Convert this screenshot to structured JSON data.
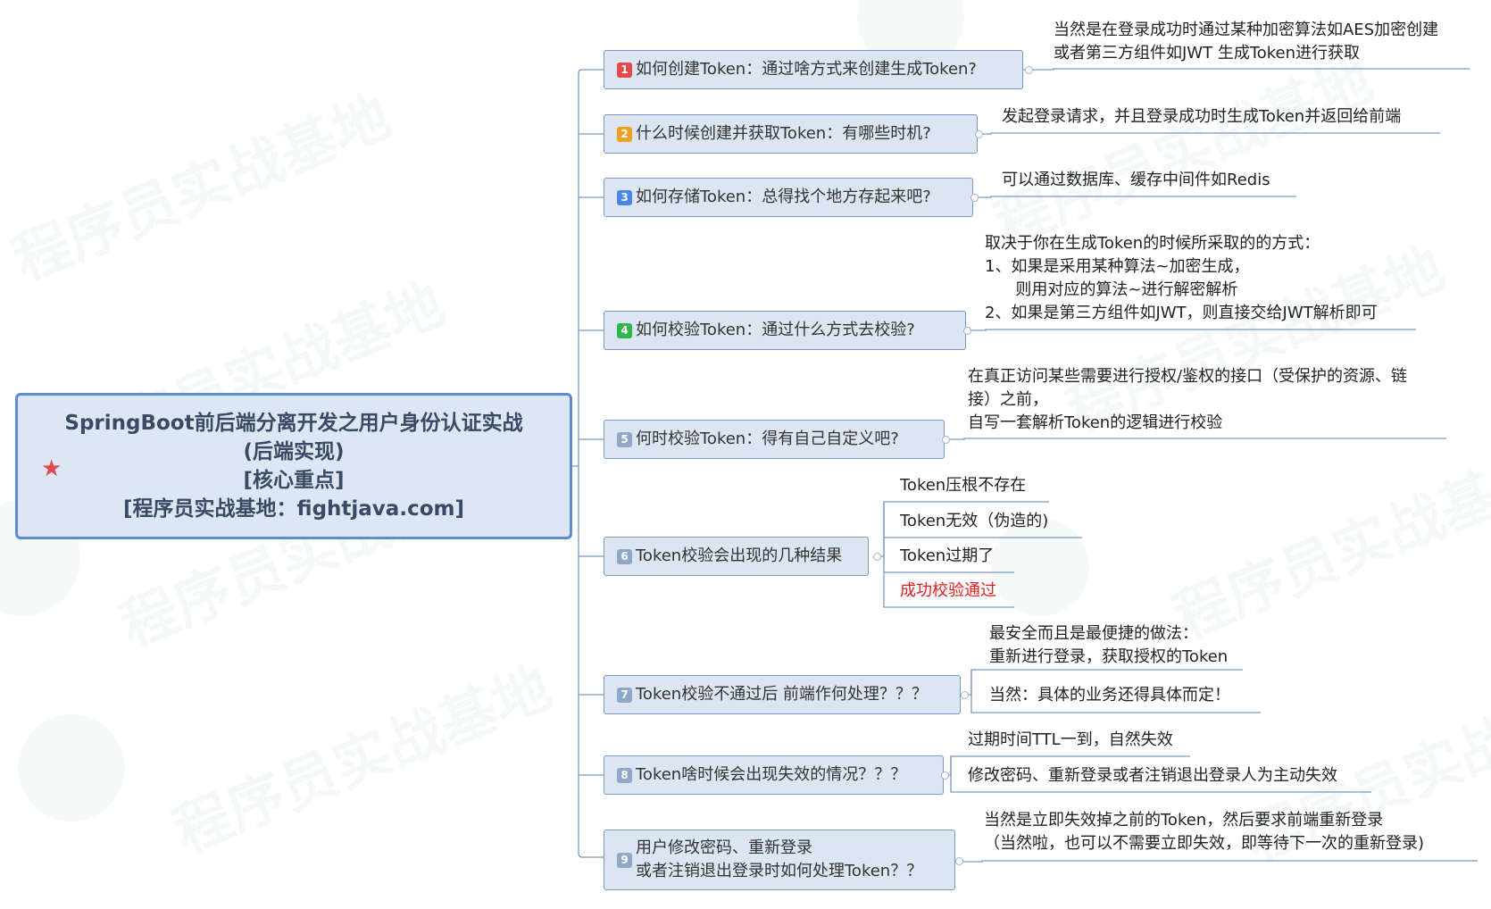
{
  "root": {
    "lines": [
      "SpringBoot前后端分离开发之用户身份认证实战",
      "(后端实现)",
      "[核心重点]",
      "[程序员实战基地：fightjava.com]"
    ],
    "marker_icon": "star-icon"
  },
  "watermark": "程序员实战基地",
  "topics": [
    {
      "badge": "1",
      "badge_color": "#e5484d",
      "label": "如何创建Token：通过啥方式来创建生成Token?"
    },
    {
      "badge": "2",
      "badge_color": "#f0a020",
      "label": "什么时候创建并获取Token：有哪些时机?"
    },
    {
      "badge": "3",
      "badge_color": "#4a86e8",
      "label": "如何存储Token：总得找个地方存起来吧?"
    },
    {
      "badge": "4",
      "badge_color": "#2eb84b",
      "label": "如何校验Token：通过什么方式去校验?"
    },
    {
      "badge": "5",
      "badge_color": "#8fa8c8",
      "label": "何时校验Token：得有自己自定义吧?"
    },
    {
      "badge": "6",
      "badge_color": "#8fa8c8",
      "label": "Token校验会出现的几种结果"
    },
    {
      "badge": "7",
      "badge_color": "#8fa8c8",
      "label": "Token校验不通过后 前端作何处理？？？"
    },
    {
      "badge": "8",
      "badge_color": "#8fa8c8",
      "label": "Token啥时候会出现失效的情况？？？"
    },
    {
      "badge": "9",
      "badge_color": "#8fa8c8",
      "label_lines": [
        "用户修改密码、重新登录",
        "或者注销退出登录时如何处理Token？？"
      ]
    }
  ],
  "notes": {
    "t1": [
      "当然是在登录成功时通过某种加密算法如AES加密创建",
      "或者第三方组件如JWT  生成Token进行获取"
    ],
    "t2": [
      "发起登录请求，并且登录成功时生成Token并返回给前端"
    ],
    "t3": [
      "可以通过数据库、缓存中间件如Redis"
    ],
    "t4": [
      "取决于你在生成Token的时候所采取的的方式：",
      "1、如果是采用某种算法~加密生成，",
      "      则用对应的算法~进行解密解析",
      "2、如果是第三方组件如JWT，则直接交给JWT解析即可"
    ],
    "t5": [
      "在真正访问某些需要进行授权/鉴权的接口（受保护的资源、链",
      "接）之前，",
      "自写一套解析Token的逻辑进行校验"
    ],
    "t6": [
      "Token压根不存在",
      "Token无效（伪造的)",
      "Token过期了",
      "成功校验通过"
    ],
    "t7a": [
      "最安全而且是最便捷的做法：",
      "重新进行登录，获取授权的Token"
    ],
    "t7b": [
      "当然：具体的业务还得具体而定！"
    ],
    "t8a": [
      "过期时间TTL一到，自然失效"
    ],
    "t8b": [
      "修改密码、重新登录或者注销退出登录人为主动失效"
    ],
    "t9": [
      "当然是立即失效掉之前的Token，然后要求前端重新登录",
      "（当然啦，也可以不需要立即失效，即等待下一次的重新登录)"
    ]
  },
  "colors": {
    "line": "#7a98c6",
    "topic_bg": "#dce5f2",
    "root_bg": "#dde6f3",
    "root_border": "#5b8bd0",
    "highlight_red": "#e02020"
  }
}
